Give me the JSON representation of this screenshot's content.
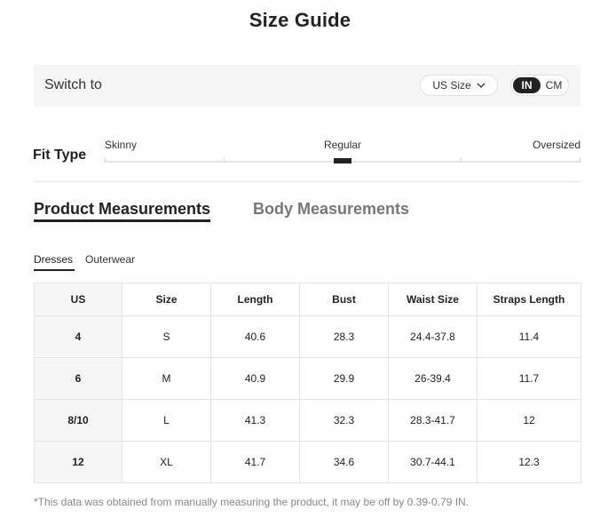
{
  "header": {
    "title": "Size Guide"
  },
  "switch_bar": {
    "label": "Switch to",
    "size_select": {
      "value": "US Size",
      "icon": "chevron-down-icon"
    },
    "units": [
      {
        "label": "IN",
        "active": true
      },
      {
        "label": "CM",
        "active": false
      }
    ]
  },
  "fit_type": {
    "label": "Fit Type",
    "options": [
      "Skinny",
      "Regular",
      "Oversized"
    ],
    "selected": "Regular"
  },
  "tabs": {
    "product": "Product Measurements",
    "body": "Body Measurements",
    "active": "Product Measurements"
  },
  "subtabs": {
    "dresses": "Dresses",
    "outerwear": "Outerwear",
    "active": "Dresses"
  },
  "table": {
    "headers": [
      "US",
      "Size",
      "Length",
      "Bust",
      "Waist Size",
      "Straps Length"
    ],
    "rows": [
      [
        "4",
        "S",
        "40.6",
        "28.3",
        "24.4-37.8",
        "11.4"
      ],
      [
        "6",
        "M",
        "40.9",
        "29.9",
        "26-39.4",
        "11.7"
      ],
      [
        "8/10",
        "L",
        "41.3",
        "32.3",
        "28.3-41.7",
        "12"
      ],
      [
        "12",
        "XL",
        "41.7",
        "34.6",
        "30.7-44.1",
        "12.3"
      ]
    ]
  },
  "footnote": "*This data was obtained from manually measuring the product, it may be off by 0.39-0.79 IN.",
  "colors": {
    "accent": "#222222",
    "panel": "#f6f6f6",
    "muted": "#777777"
  }
}
